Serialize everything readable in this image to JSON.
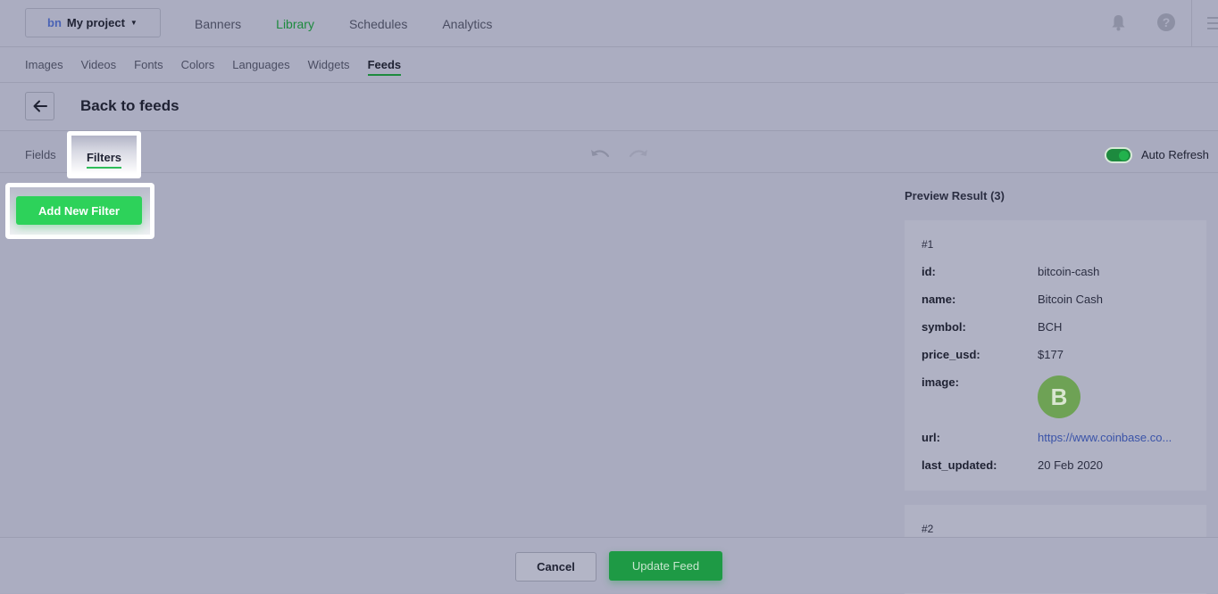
{
  "header": {
    "logo": "bn",
    "project_name": "My project",
    "nav": [
      "Banners",
      "Library",
      "Schedules",
      "Analytics"
    ],
    "active_nav": "Library"
  },
  "subnav": {
    "items": [
      "Images",
      "Videos",
      "Fonts",
      "Colors",
      "Languages",
      "Widgets",
      "Feeds"
    ],
    "active": "Feeds"
  },
  "back": {
    "title": "Back to feeds"
  },
  "tabs": {
    "fields": "Fields",
    "filters": "Filters",
    "auto_refresh_label": "Auto Refresh"
  },
  "filters": {
    "add_button": "Add New Filter"
  },
  "preview": {
    "title": "Preview Result (3)",
    "card1": {
      "number": "#1",
      "rows": [
        {
          "key": "id:",
          "value": "bitcoin-cash"
        },
        {
          "key": "name:",
          "value": "Bitcoin Cash"
        },
        {
          "key": "symbol:",
          "value": "BCH"
        },
        {
          "key": "price_usd:",
          "value": "$177"
        },
        {
          "key": "image:",
          "value": ""
        },
        {
          "key": "url:",
          "value": "https://www.coinbase.co..."
        },
        {
          "key": "last_updated:",
          "value": "20 Feb 2020"
        }
      ],
      "coin_glyph": "B"
    },
    "card2": {
      "number": "#2"
    }
  },
  "footer": {
    "cancel": "Cancel",
    "update": "Update Feed"
  },
  "colors": {
    "accent_green": "#2dd25a",
    "active_nav": "#1d8a3e"
  }
}
